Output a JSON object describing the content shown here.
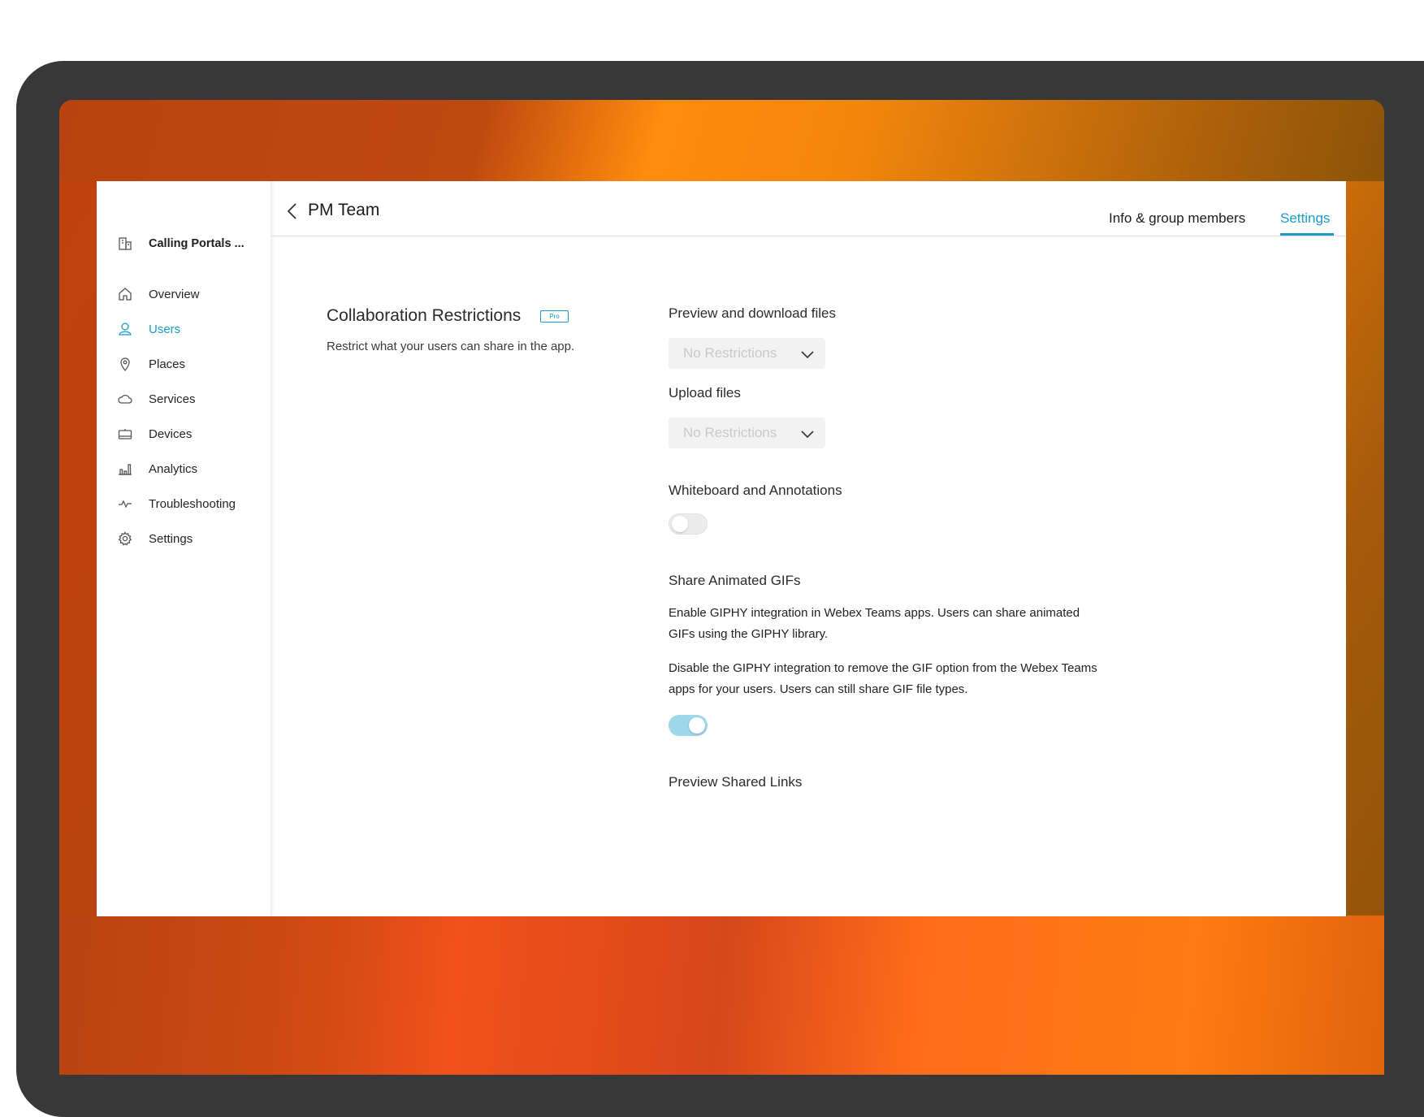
{
  "org": {
    "name": "Calling Portals ...",
    "icon": "building-icon"
  },
  "sidebar": {
    "items": [
      {
        "label": "Overview",
        "icon": "home-icon",
        "active": false
      },
      {
        "label": "Users",
        "icon": "user-icon",
        "active": true
      },
      {
        "label": "Places",
        "icon": "location-pin-icon",
        "active": false
      },
      {
        "label": "Services",
        "icon": "cloud-icon",
        "active": false
      },
      {
        "label": "Devices",
        "icon": "device-icon",
        "active": false
      },
      {
        "label": "Analytics",
        "icon": "bar-chart-icon",
        "active": false
      },
      {
        "label": "Troubleshooting",
        "icon": "pulse-icon",
        "active": false
      },
      {
        "label": "Settings",
        "icon": "gear-icon",
        "active": false
      }
    ]
  },
  "header": {
    "title": "PM Team",
    "tabs": [
      {
        "label": "Info & group members",
        "active": false
      },
      {
        "label": "Settings",
        "active": true
      }
    ]
  },
  "section": {
    "title": "Collaboration Restrictions",
    "badge": "Pro",
    "description": "Restrict what your users can share in the app."
  },
  "settings": {
    "preview_download": {
      "label": "Preview and download files",
      "value": "No Restrictions"
    },
    "upload": {
      "label": "Upload files",
      "value": "No Restrictions"
    },
    "whiteboard": {
      "label": "Whiteboard and Annotations",
      "enabled": false
    },
    "gifs": {
      "label": "Share Animated GIFs",
      "para1": "Enable GIPHY integration in Webex Teams apps. Users can share animated GIFs using the GIPHY library.",
      "para2": "Disable the GIPHY integration to remove the GIF option from the Webex Teams apps for your users. Users can still share GIF file types.",
      "enabled": true
    },
    "preview_links": {
      "label": "Preview Shared Links"
    }
  },
  "colors": {
    "accent": "#1a9ccb",
    "toggle_on": "#9fd6ea"
  }
}
